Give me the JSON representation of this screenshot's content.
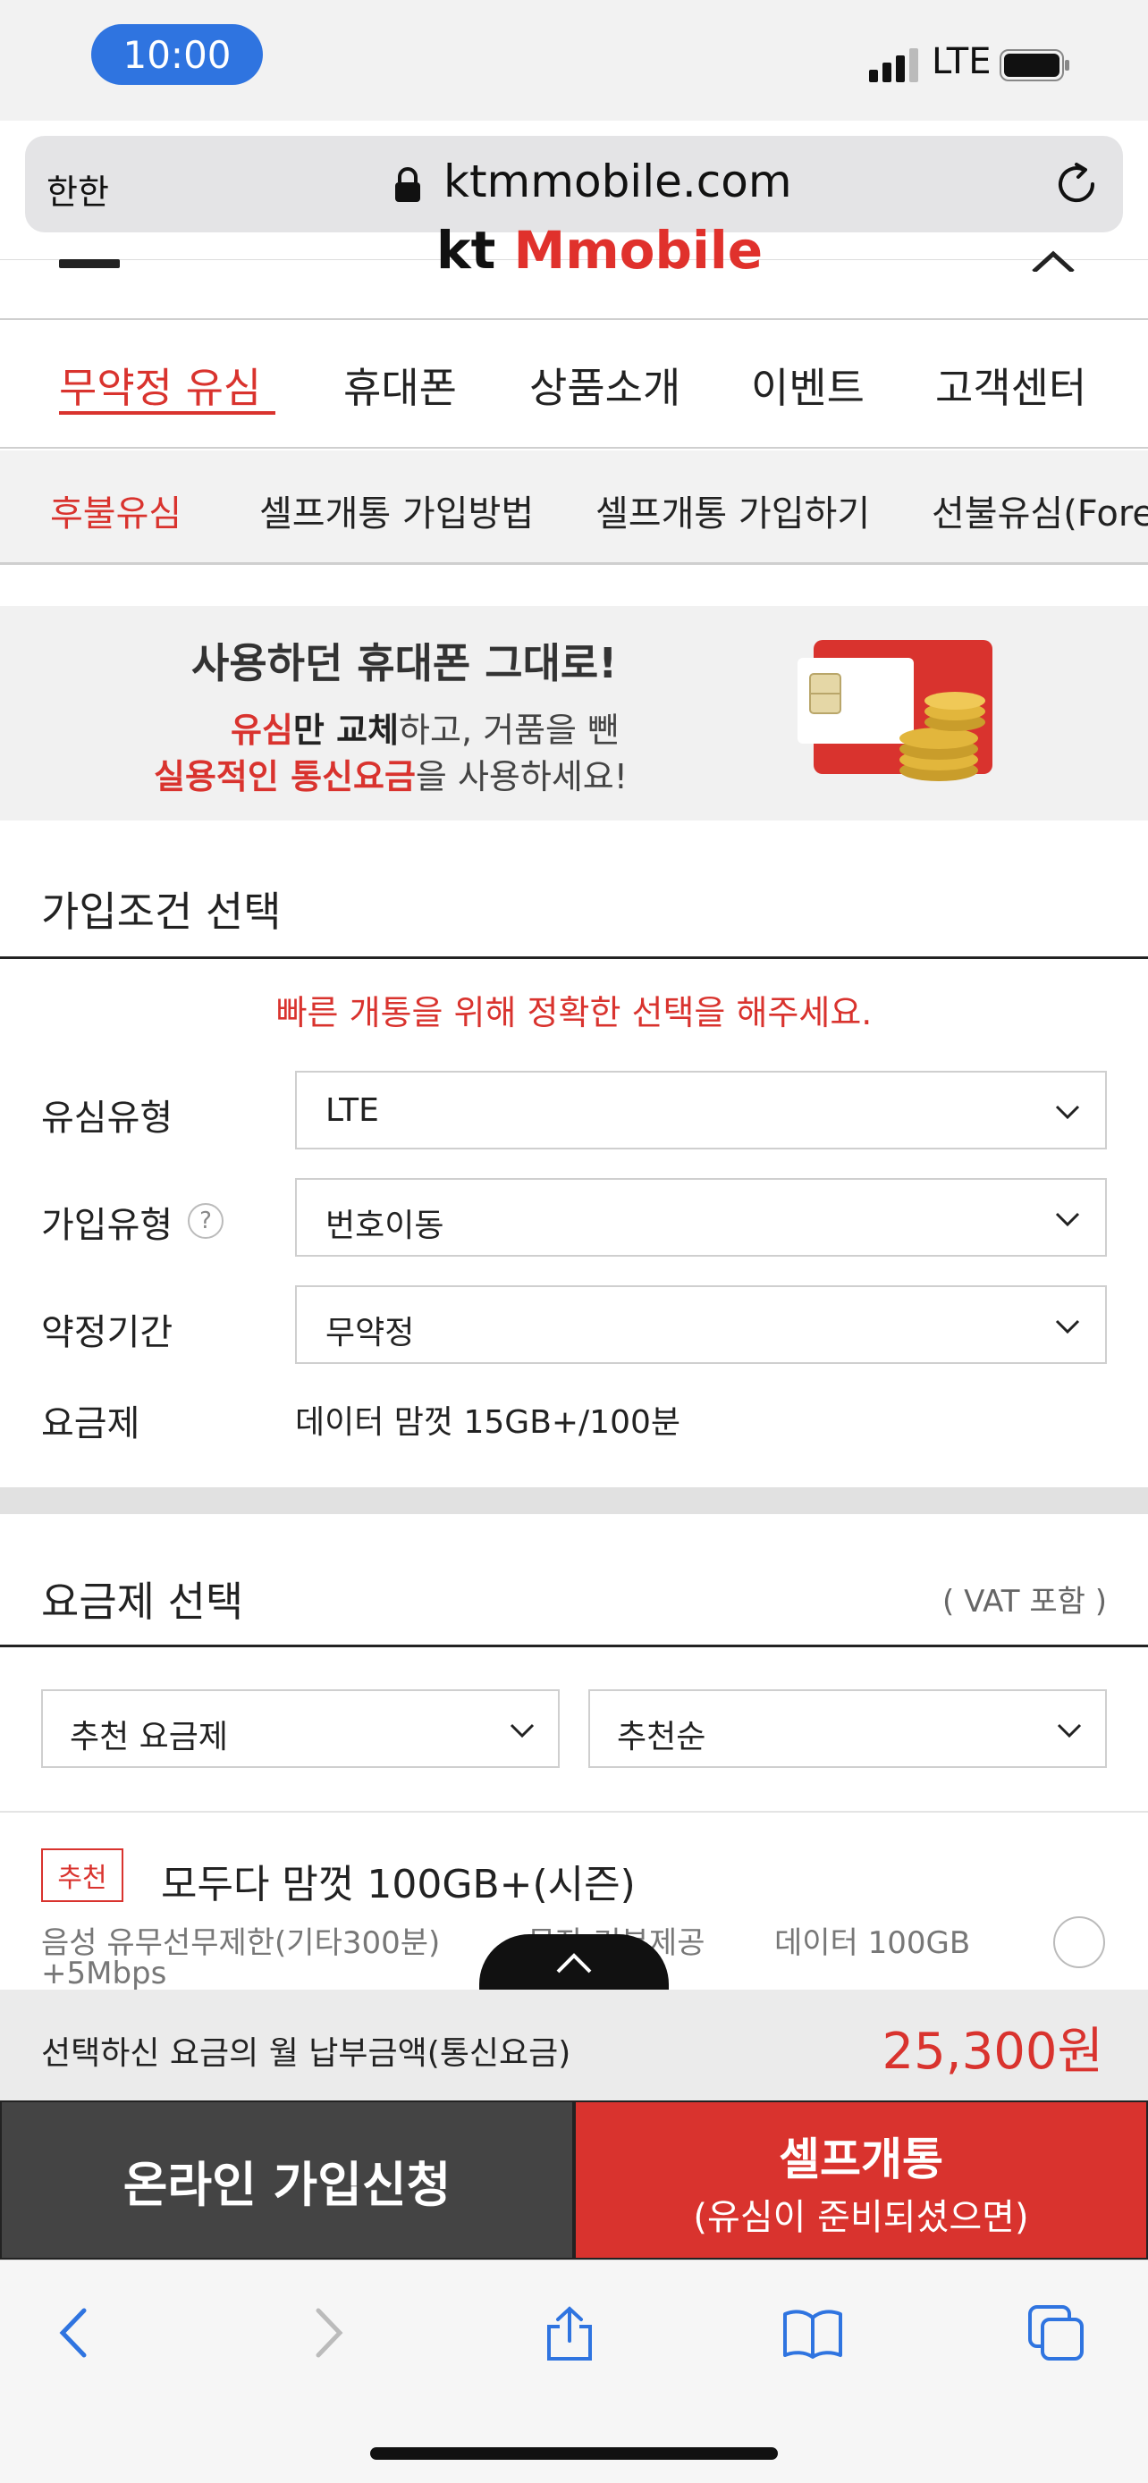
{
  "status": {
    "time": "10:00",
    "network": "LTE"
  },
  "browser": {
    "aa_label": "한한",
    "domain": "ktmmobile.com"
  },
  "header": {
    "logo_kt": "kt",
    "logo_text": "Mmobile"
  },
  "main_nav": [
    "무약정 유심",
    "휴대폰",
    "상품소개",
    "이벤트",
    "고객센터"
  ],
  "sub_nav": [
    "후불유심",
    "셀프개통 가입방법",
    "셀프개통 가입하기",
    "선불유심(Fore"
  ],
  "banner": {
    "title": "사용하던 휴대폰 그대로!",
    "line2_a": "유심",
    "line2_b": "만 ",
    "line2_c": "교체",
    "line2_d": "하고, 거품을 뺀",
    "line3_a": "실용적인 통신요금",
    "line3_b": "을 사용하세요!"
  },
  "conditions": {
    "title": "가입조건 선택",
    "notice": "빠른 개통을 위해 정확한 선택을 해주세요.",
    "sim_type_label": "유심유형",
    "sim_type_value": "LTE",
    "join_type_label": "가입유형",
    "join_type_value": "번호이동",
    "help": "?",
    "contract_label": "약정기간",
    "contract_value": "무약정",
    "plan_label": "요금제",
    "plan_value": "데이터 맘껏 15GB+/100분"
  },
  "plan_select": {
    "title": "요금제 선택",
    "vat": "( VAT 포함 )",
    "filter": "추천 요금제",
    "sort": "추천순",
    "item": {
      "badge": "추천",
      "name": "모두다 맘껏 100GB+(시즌)",
      "voice": "음성 유무선무제한(기타300분)",
      "sms": "문자 기본제공",
      "data": "데이터 100GB",
      "speed": "+5Mbps"
    }
  },
  "total": {
    "label": "선택하신 요금의 월 납부금액(통신요금)",
    "amount": "25,300원"
  },
  "actions": {
    "online": "온라인 가입신청",
    "self_line1": "셀프개통",
    "self_line2": "(유심이 준비되셨으면)"
  },
  "colors": {
    "accent_red": "#d9332e",
    "ios_blue": "#2f74e0",
    "dark_button": "#444444"
  }
}
